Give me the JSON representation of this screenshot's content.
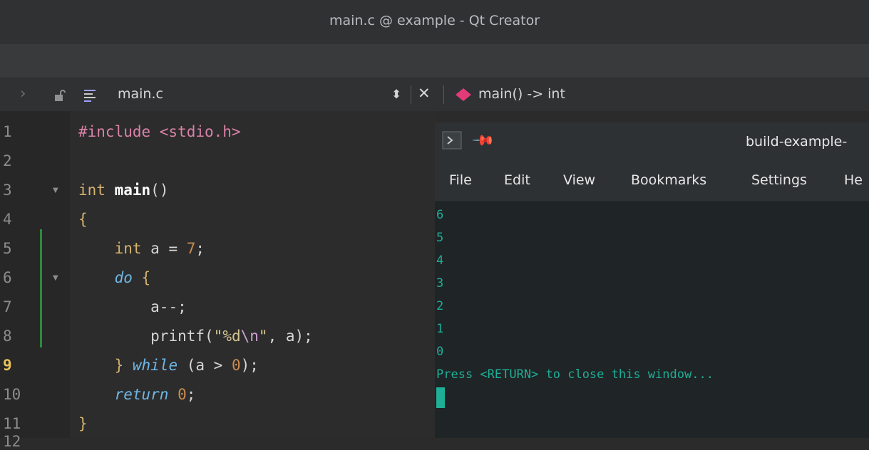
{
  "window": {
    "title": "main.c @ example - Qt Creator"
  },
  "editor_toolbar": {
    "file_name": "main.c",
    "function_label": "main() -> int"
  },
  "gutter": {
    "line_numbers": [
      "1",
      "2",
      "3",
      "4",
      "5",
      "6",
      "7",
      "8",
      "9",
      "10",
      "11",
      "12"
    ],
    "current_line": "9"
  },
  "code": {
    "l1_pp": "#include <stdio.h>",
    "l3_type": "int",
    "l3_name": "main",
    "l3_paren": "()",
    "l4": "{",
    "l5_type": "int",
    "l5_decl": " a = ",
    "l5_num": "7",
    "l5_semi": ";",
    "l6_do": "do",
    "l6_brace": " {",
    "l7": "a--;",
    "l8_call": "printf(",
    "l8_str1": "\"%d",
    "l8_esc": "\\n",
    "l8_str2": "\"",
    "l8_rest": ", a);",
    "l9_brace": "} ",
    "l9_while": "while",
    "l9_cond": " (a > ",
    "l9_num": "0",
    "l9_end": ");",
    "l10_return": "return",
    "l10_num": "0",
    "l10_semi": ";",
    "l11": "}"
  },
  "terminal": {
    "title": "build-example-",
    "menu": [
      "File",
      "Edit",
      "View",
      "Bookmarks",
      "Settings",
      "He"
    ],
    "output": [
      "6",
      "5",
      "4",
      "3",
      "2",
      "1",
      "0",
      "Press <RETURN> to close this window..."
    ]
  },
  "colors": {
    "terminal_text": "#1fae96",
    "current_line_number": "#e8c35a",
    "change_marker": "#2e8b3a"
  }
}
